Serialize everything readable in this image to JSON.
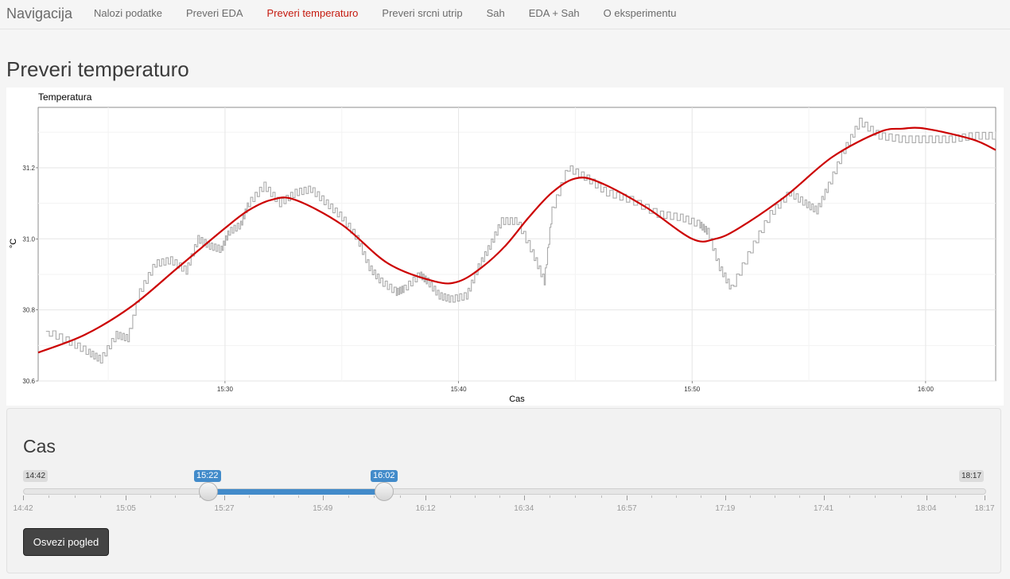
{
  "navbar": {
    "brand": "Navigacija",
    "items": [
      {
        "label": "Nalozi podatke",
        "active": false
      },
      {
        "label": "Preveri EDA",
        "active": false
      },
      {
        "label": "Preveri temperaturo",
        "active": true
      },
      {
        "label": "Preveri srcni utrip",
        "active": false
      },
      {
        "label": "Sah",
        "active": false
      },
      {
        "label": "EDA + Sah",
        "active": false
      },
      {
        "label": "O eksperimentu",
        "active": false
      }
    ],
    "active_color": "#c51a0f"
  },
  "page": {
    "title": "Preveri temperaturo"
  },
  "chart_data": {
    "type": "line",
    "title": "Temperatura",
    "xlabel": "Cas",
    "ylabel": "°C",
    "xlim": [
      "15:22",
      "16:03"
    ],
    "ylim": [
      30.6,
      31.37
    ],
    "x_ticks": [
      "15:30",
      "15:40",
      "15:50",
      "16:00"
    ],
    "y_ticks": [
      "30.6",
      "30.8",
      "31.0",
      "31.2"
    ],
    "grid": true,
    "series": [
      {
        "name": "",
        "color": "#aaaaaa",
        "x": [
          "15:22:20",
          "15:23:20",
          "15:24:10",
          "15:24:40",
          "15:25:20",
          "15:25:50",
          "15:26:20",
          "15:27:00",
          "15:27:40",
          "15:28:20",
          "15:28:50",
          "15:29:20",
          "15:29:50",
          "15:30:10",
          "15:30:40",
          "15:31:00",
          "15:31:40",
          "15:32:20",
          "15:33:00",
          "15:33:40",
          "15:34:20",
          "15:35:00",
          "15:35:40",
          "15:36:10",
          "15:36:40",
          "15:37:20",
          "15:37:40",
          "15:38:20",
          "15:38:40",
          "15:39:10",
          "15:39:40",
          "15:40:20",
          "15:40:50",
          "15:41:20",
          "15:41:50",
          "15:42:30",
          "15:43:10",
          "15:43:40",
          "15:44:00",
          "15:44:40",
          "15:45:30",
          "15:46:20",
          "15:47:20",
          "15:48:30",
          "15:49:30",
          "15:50:20",
          "15:50:40",
          "15:51:10",
          "15:51:40",
          "15:52:30",
          "15:53:20",
          "15:54:10",
          "15:54:50",
          "15:55:20",
          "15:55:50",
          "15:56:30",
          "15:57:10",
          "15:58:00",
          "15:59:00",
          "16:00:00",
          "16:01:00",
          "16:02:00",
          "16:03:00"
        ],
        "values": [
          30.74,
          30.71,
          30.68,
          30.66,
          30.73,
          30.72,
          30.85,
          30.93,
          30.94,
          30.91,
          31.0,
          30.98,
          30.97,
          31.02,
          31.04,
          31.1,
          31.15,
          31.1,
          31.13,
          31.14,
          31.1,
          31.06,
          31.0,
          30.92,
          30.88,
          30.85,
          30.86,
          30.9,
          30.88,
          30.84,
          30.83,
          30.84,
          30.92,
          30.98,
          31.05,
          31.05,
          30.96,
          30.88,
          31.08,
          31.2,
          31.17,
          31.13,
          31.11,
          31.07,
          31.06,
          31.04,
          31.02,
          30.92,
          30.86,
          30.97,
          31.07,
          31.13,
          31.1,
          31.08,
          31.15,
          31.25,
          31.33,
          31.29,
          31.28,
          31.28,
          31.28,
          31.29,
          31.29
        ]
      },
      {
        "name": "",
        "color": "#cc0000",
        "x": [
          "15:22",
          "15:24",
          "15:26",
          "15:28",
          "15:30",
          "15:31",
          "15:32",
          "15:33",
          "15:35",
          "15:37",
          "15:39",
          "15:40",
          "15:41",
          "15:42",
          "15:43",
          "15:44",
          "15:45",
          "15:46",
          "15:48",
          "15:50",
          "15:51",
          "15:52",
          "15:54",
          "15:56",
          "15:58",
          "15:59",
          "16:00",
          "16:02",
          "16:03"
        ],
        "values": [
          30.68,
          30.73,
          30.81,
          30.92,
          31.03,
          31.08,
          31.11,
          31.11,
          31.04,
          30.93,
          30.88,
          30.88,
          30.92,
          30.98,
          31.06,
          31.13,
          31.17,
          31.16,
          31.09,
          31.0,
          31.0,
          31.03,
          31.12,
          31.23,
          31.3,
          31.31,
          31.31,
          31.28,
          31.25
        ]
      }
    ]
  },
  "control": {
    "title": "Cas",
    "range_min": "14:42",
    "range_max": "18:17",
    "from": "15:22",
    "to": "16:02",
    "ticks": [
      "14:42",
      "15:05",
      "15:27",
      "15:49",
      "16:12",
      "16:34",
      "16:57",
      "17:19",
      "17:41",
      "18:04",
      "18:17"
    ],
    "accent_color": "#428bca",
    "button_label": "Osvezi pogled"
  }
}
